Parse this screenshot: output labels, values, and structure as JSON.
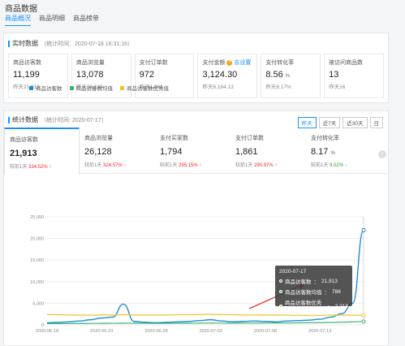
{
  "page_title": "商品数据",
  "tabs": [
    {
      "label": "商品概况",
      "active": true
    },
    {
      "label": "商品明细",
      "active": false
    },
    {
      "label": "商品榜单",
      "active": false
    }
  ],
  "realtime": {
    "title": "实时数据",
    "subtitle": "（统计时间：2020-07-18 16:31:16）",
    "metrics": [
      {
        "label": "商品访客数",
        "value": "11,199",
        "prev": "昨天21,913"
      },
      {
        "label": "商品浏览量",
        "value": "13,078",
        "prev": "昨天26,128"
      },
      {
        "label": "支付订单数",
        "value": "972",
        "prev": "昨天1,861"
      },
      {
        "label": "支付金额",
        "link": "去设置",
        "value": "3,124.30",
        "prev": "昨天6,164.13"
      },
      {
        "label": "支付转化率",
        "value": "8.56",
        "unit": "%",
        "prev": "昨天8.17%"
      },
      {
        "label": "被访问商品数",
        "value": "13",
        "prev": "昨天16"
      }
    ]
  },
  "stats": {
    "title": "统计数据",
    "subtitle": "（统计时间: 2020-07-17）",
    "ranges": [
      {
        "label": "昨天",
        "active": true
      },
      {
        "label": "近7天",
        "active": false
      },
      {
        "label": "近30天",
        "active": false
      },
      {
        "label": "日",
        "active": false
      }
    ],
    "metrics": [
      {
        "label": "商品访客数",
        "value": "21,913",
        "cmp_label": "较前1天",
        "cmp": "334.52%",
        "dir": "↑",
        "trend": "up",
        "active": true
      },
      {
        "label": "商品浏览量",
        "value": "26,128",
        "cmp_label": "较前1天",
        "cmp": "324.57%",
        "dir": "↑",
        "trend": "up",
        "active": false
      },
      {
        "label": "支付买家数",
        "value": "1,794",
        "cmp_label": "较前1天",
        "cmp": "295.15%",
        "dir": "↑",
        "trend": "up",
        "active": false
      },
      {
        "label": "支付订单数",
        "value": "1,861",
        "cmp_label": "较前1天",
        "cmp": "290.97%",
        "dir": "↑",
        "trend": "up",
        "active": false
      },
      {
        "label": "支付转化率",
        "value": "8.17",
        "unit": "%",
        "cmp_label": "较前1天",
        "cmp": "9.02%",
        "dir": "↓",
        "trend": "down",
        "active": false
      }
    ],
    "next_icon": "›"
  },
  "colors": {
    "accent": "#1890ff",
    "series_visitors": "#1f8dd6",
    "series_avg": "#3cb371",
    "series_excellent": "#f2c230",
    "up": "#f5222d",
    "down": "#2ca02c"
  },
  "chart_data": {
    "type": "line",
    "xlim": [
      "2020-06-18",
      "2020-07-17"
    ],
    "x_ticks": [
      "2020-06-18",
      "2020-06-23",
      "2020-06-28",
      "2020-07-03",
      "2020-07-08",
      "2020-07-13"
    ],
    "ylim": [
      0,
      25000
    ],
    "y_ticks": [
      "0",
      "5,000",
      "10,000",
      "15,000",
      "20,000",
      "25,000"
    ],
    "grid": true,
    "legend_position": "top-left",
    "x": [
      "2020-06-18",
      "2020-06-19",
      "2020-06-20",
      "2020-06-21",
      "2020-06-22",
      "2020-06-23",
      "2020-06-24",
      "2020-06-25",
      "2020-06-26",
      "2020-06-27",
      "2020-06-28",
      "2020-06-29",
      "2020-06-30",
      "2020-07-01",
      "2020-07-02",
      "2020-07-03",
      "2020-07-04",
      "2020-07-05",
      "2020-07-06",
      "2020-07-07",
      "2020-07-08",
      "2020-07-09",
      "2020-07-10",
      "2020-07-11",
      "2020-07-12",
      "2020-07-13",
      "2020-07-14",
      "2020-07-15",
      "2020-07-16",
      "2020-07-17"
    ],
    "series": [
      {
        "name": "商品访客数",
        "values": [
          500,
          600,
          700,
          900,
          1200,
          1600,
          1800,
          4800,
          800,
          600,
          500,
          600,
          700,
          800,
          1000,
          1200,
          900,
          700,
          800,
          900,
          800,
          700,
          900,
          1000,
          1100,
          1300,
          1800,
          2600,
          5000,
          21913
        ]
      },
      {
        "name": "商品访客数均值",
        "values": [
          300,
          300,
          320,
          330,
          340,
          350,
          360,
          400,
          380,
          360,
          350,
          360,
          370,
          380,
          400,
          420,
          410,
          400,
          410,
          420,
          430,
          440,
          450,
          470,
          500,
          520,
          560,
          620,
          700,
          786
        ]
      },
      {
        "name": "商品访客数优秀值",
        "values": [
          2400,
          2350,
          2300,
          2250,
          2250,
          2300,
          2300,
          2350,
          2300,
          2250,
          2250,
          2300,
          2350,
          2350,
          2400,
          2450,
          2400,
          2350,
          2300,
          2300,
          2250,
          2250,
          2250,
          2200,
          2200,
          2200,
          2250,
          2250,
          2250,
          2218
        ]
      }
    ]
  },
  "tooltip": {
    "date": "2020-07-17",
    "rows": [
      {
        "label": "商品访客数",
        "value": "21,913"
      },
      {
        "label": "商品访客数均值",
        "value": "786"
      },
      {
        "label": "商品访客数优秀值",
        "value": "2,218"
      }
    ]
  }
}
